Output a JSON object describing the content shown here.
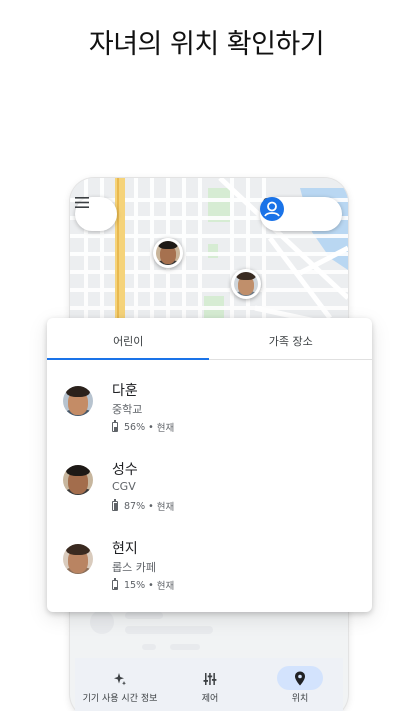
{
  "headline": "자녀의 위치 확인하기",
  "map": {
    "menu_icon": "hamburger-menu-icon",
    "bell_icon": "notification-bell-icon",
    "account_icon": "account-circle-icon",
    "accent_color": "#1a73e8"
  },
  "tabs": [
    {
      "label": "어린이",
      "selected": true
    },
    {
      "label": "가족 장소",
      "selected": false
    }
  ],
  "children": [
    {
      "name": "다훈",
      "place": "중학교",
      "battery": "56%",
      "separator": "•",
      "time": "현재",
      "battery_level": 0.56
    },
    {
      "name": "성수",
      "place": "CGV",
      "battery": "87%",
      "separator": "•",
      "time": "현재",
      "battery_level": 0.87
    },
    {
      "name": "현지",
      "place": "롭스 카페",
      "battery": "15%",
      "separator": "•",
      "time": "현재",
      "battery_level": 0.15
    }
  ],
  "bottom_nav": [
    {
      "label": "기기 사용 시간 정보",
      "icon": "sparkle-icon",
      "active": false
    },
    {
      "label": "제어",
      "icon": "sliders-icon",
      "active": false
    },
    {
      "label": "위치",
      "icon": "location-pin-icon",
      "active": true
    }
  ]
}
